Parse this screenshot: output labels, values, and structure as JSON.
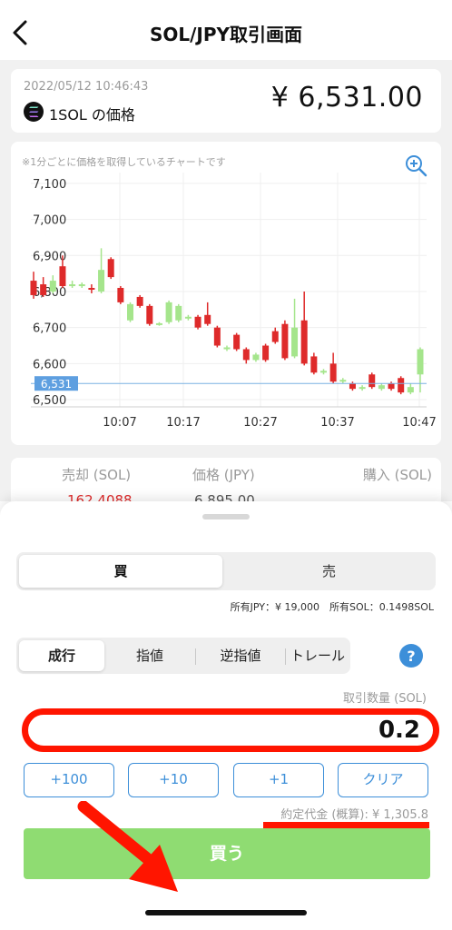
{
  "header": {
    "title": "SOL/JPY取引画面"
  },
  "price_card": {
    "timestamp": "2022/05/12 10:46:43",
    "label": "1SOL の価格",
    "price": "¥ 6,531.00"
  },
  "chart_note": "※1分ごとに価格を取得しているチャートです",
  "chart_data": {
    "type": "candlestick",
    "ylim": [
      6480,
      7130
    ],
    "y_ticks": [
      "7,100",
      "7,000",
      "6,900",
      "6,800",
      "6,700",
      "6,600",
      "6,500"
    ],
    "x_ticks": [
      "10:07",
      "10:17",
      "10:27",
      "10:37",
      "10:47"
    ],
    "current_price_label": "6,531",
    "current_price": 6545,
    "colors": {
      "up": "#a5e58c",
      "down": "#de2a2a"
    },
    "candles": [
      {
        "dir": "down",
        "o": 6830,
        "c": 6790,
        "h": 6855,
        "l": 6780
      },
      {
        "dir": "down",
        "o": 6820,
        "c": 6790,
        "h": 6840,
        "l": 6785
      },
      {
        "dir": "up",
        "o": 6800,
        "c": 6830,
        "h": 6845,
        "l": 6795
      },
      {
        "dir": "down",
        "o": 6870,
        "c": 6815,
        "h": 6900,
        "l": 6810
      },
      {
        "dir": "up",
        "o": 6815,
        "c": 6820,
        "h": 6830,
        "l": 6810
      },
      {
        "dir": "up",
        "o": 6815,
        "c": 6820,
        "h": 6825,
        "l": 6810
      },
      {
        "dir": "down",
        "o": 6810,
        "c": 6805,
        "h": 6820,
        "l": 6795
      },
      {
        "dir": "up",
        "o": 6800,
        "c": 6860,
        "h": 6920,
        "l": 6795
      },
      {
        "dir": "down",
        "o": 6890,
        "c": 6840,
        "h": 6895,
        "l": 6835
      },
      {
        "dir": "down",
        "o": 6810,
        "c": 6770,
        "h": 6815,
        "l": 6765
      },
      {
        "dir": "up",
        "o": 6720,
        "c": 6765,
        "h": 6770,
        "l": 6715
      },
      {
        "dir": "down",
        "o": 6785,
        "c": 6760,
        "h": 6790,
        "l": 6755
      },
      {
        "dir": "down",
        "o": 6760,
        "c": 6710,
        "h": 6765,
        "l": 6705
      },
      {
        "dir": "up",
        "o": 6710,
        "c": 6712,
        "h": 6715,
        "l": 6705
      },
      {
        "dir": "up",
        "o": 6715,
        "c": 6770,
        "h": 6775,
        "l": 6710
      },
      {
        "dir": "up",
        "o": 6720,
        "c": 6760,
        "h": 6765,
        "l": 6715
      },
      {
        "dir": "up",
        "o": 6725,
        "c": 6730,
        "h": 6735,
        "l": 6720
      },
      {
        "dir": "down",
        "o": 6730,
        "c": 6700,
        "h": 6735,
        "l": 6695
      },
      {
        "dir": "down",
        "o": 6735,
        "c": 6710,
        "h": 6770,
        "l": 6705
      },
      {
        "dir": "down",
        "o": 6700,
        "c": 6650,
        "h": 6705,
        "l": 6645
      },
      {
        "dir": "up",
        "o": 6640,
        "c": 6645,
        "h": 6650,
        "l": 6635
      },
      {
        "dir": "down",
        "o": 6680,
        "c": 6640,
        "h": 6685,
        "l": 6635
      },
      {
        "dir": "down",
        "o": 6640,
        "c": 6610,
        "h": 6645,
        "l": 6600
      },
      {
        "dir": "up",
        "o": 6610,
        "c": 6625,
        "h": 6630,
        "l": 6605
      },
      {
        "dir": "down",
        "o": 6650,
        "c": 6610,
        "h": 6655,
        "l": 6605
      },
      {
        "dir": "down",
        "o": 6690,
        "c": 6660,
        "h": 6700,
        "l": 6655
      },
      {
        "dir": "down",
        "o": 6710,
        "c": 6615,
        "h": 6720,
        "l": 6610
      },
      {
        "dir": "up",
        "o": 6620,
        "c": 6700,
        "h": 6780,
        "l": 6615
      },
      {
        "dir": "down",
        "o": 6720,
        "c": 6600,
        "h": 6800,
        "l": 6595
      },
      {
        "dir": "down",
        "o": 6620,
        "c": 6575,
        "h": 6630,
        "l": 6570
      },
      {
        "dir": "up",
        "o": 6575,
        "c": 6580,
        "h": 6585,
        "l": 6570
      },
      {
        "dir": "down",
        "o": 6600,
        "c": 6550,
        "h": 6630,
        "l": 6545
      },
      {
        "dir": "up",
        "o": 6550,
        "c": 6555,
        "h": 6560,
        "l": 6545
      },
      {
        "dir": "down",
        "o": 6545,
        "c": 6530,
        "h": 6550,
        "l": 6525
      },
      {
        "dir": "up",
        "o": 6530,
        "c": 6535,
        "h": 6540,
        "l": 6525
      },
      {
        "dir": "down",
        "o": 6570,
        "c": 6535,
        "h": 6575,
        "l": 6530
      },
      {
        "dir": "up",
        "o": 6530,
        "c": 6540,
        "h": 6545,
        "l": 6525
      },
      {
        "dir": "down",
        "o": 6545,
        "c": 6530,
        "h": 6550,
        "l": 6525
      },
      {
        "dir": "down",
        "o": 6560,
        "c": 6520,
        "h": 6565,
        "l": 6515
      },
      {
        "dir": "up",
        "o": 6520,
        "c": 6535,
        "h": 6545,
        "l": 6515
      },
      {
        "dir": "up",
        "o": 6570,
        "c": 6640,
        "h": 6645,
        "l": 6520
      }
    ]
  },
  "orderbook": {
    "headers": {
      "sell": "売却 (SOL)",
      "price": "価格 (JPY)",
      "buy": "購入 (SOL)"
    },
    "first_row": {
      "sell": "162.4088",
      "price": "6,895.00"
    }
  },
  "trade": {
    "tabs": {
      "buy": "買",
      "sell": "売"
    },
    "holdings": "所有JPY：¥ 19,000　所有SOL：0.1498SOL",
    "order_types": [
      "成行",
      "指値",
      "逆指値",
      "トレール"
    ],
    "help": "?",
    "quantity_label": "取引数量 (SOL)",
    "quantity_value": "0.2",
    "quick_buttons": [
      "+100",
      "+10",
      "+1",
      "クリア"
    ],
    "estimate": "約定代金 (概算): ¥ 1,305.8",
    "buy_button": "買う"
  }
}
